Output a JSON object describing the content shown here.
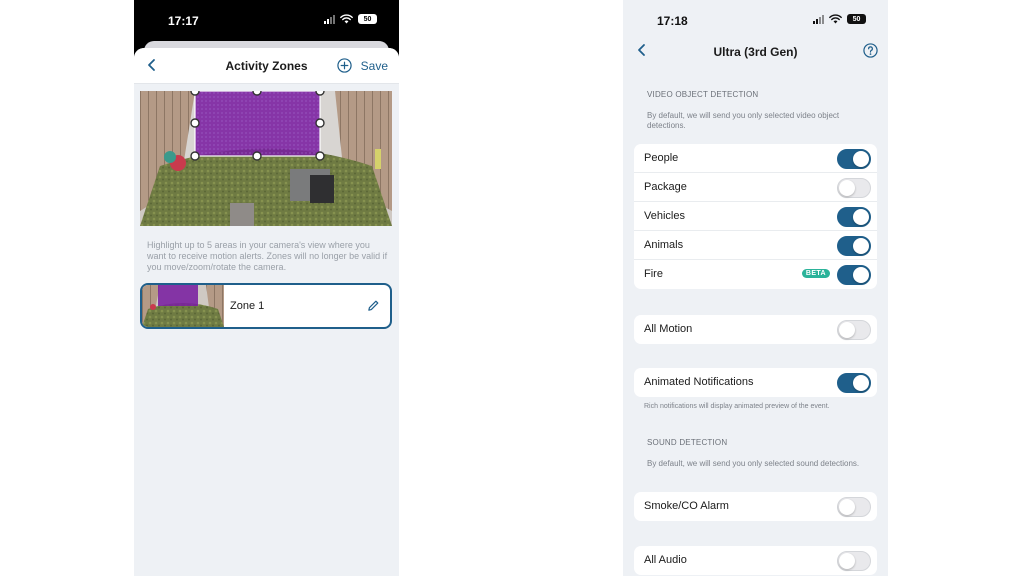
{
  "left": {
    "status": {
      "time": "17:17",
      "battery": "50"
    },
    "header": {
      "title": "Activity Zones",
      "save_label": "Save"
    },
    "hint": "Highlight up to 5 areas in your camera's view where you want to receive motion alerts. Zones will no longer be valid if you move/zoom/rotate the camera.",
    "zones": [
      {
        "name": "Zone 1"
      }
    ],
    "colors": {
      "zone": "#7a1fa0",
      "accent": "#1f5f8b"
    }
  },
  "right": {
    "status": {
      "time": "17:18",
      "battery": "50"
    },
    "nav": {
      "title": "Ultra (3rd Gen)"
    },
    "video": {
      "title": "VIDEO OBJECT DETECTION",
      "desc": "By default, we will send you only selected video object detections.",
      "items": [
        {
          "label": "People",
          "on": true
        },
        {
          "label": "Package",
          "on": false
        },
        {
          "label": "Vehicles",
          "on": true
        },
        {
          "label": "Animals",
          "on": true
        },
        {
          "label": "Fire",
          "on": true,
          "badge": "BETA"
        }
      ]
    },
    "all_motion": {
      "label": "All Motion",
      "on": false
    },
    "animated": {
      "label": "Animated Notifications",
      "on": true,
      "desc": "Rich notifications will display animated preview of the event."
    },
    "sound": {
      "title": "SOUND DETECTION",
      "desc": "By default, we will send you only selected sound detections.",
      "items": [
        {
          "label": "Smoke/CO Alarm",
          "on": false
        }
      ]
    },
    "all_audio": {
      "label": "All Audio",
      "on": false
    },
    "colors": {
      "toggle_on": "#1f5f8b",
      "badge": "#2bb39a"
    }
  }
}
